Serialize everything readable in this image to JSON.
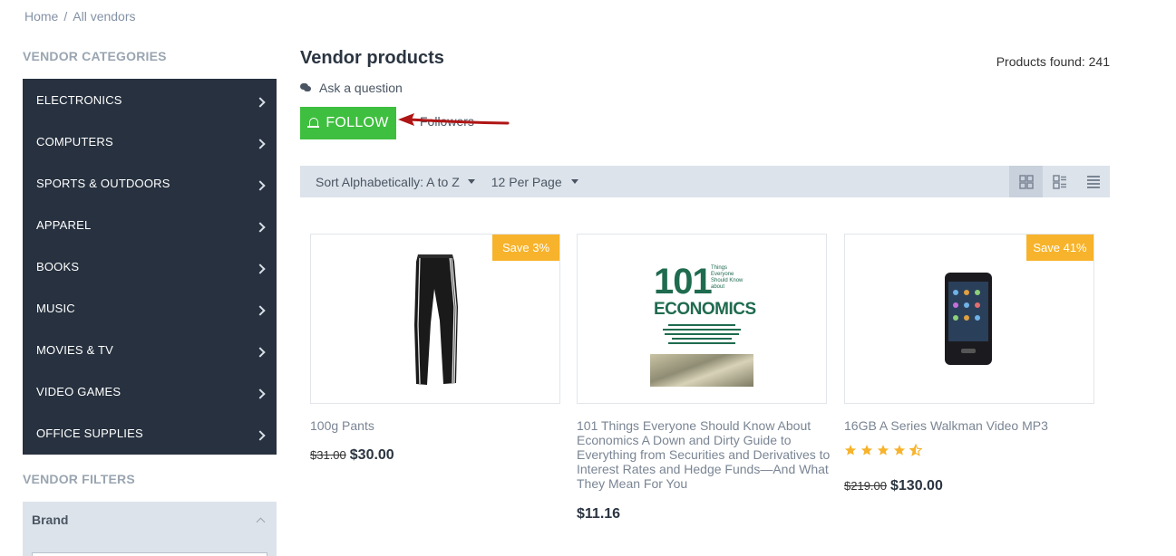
{
  "breadcrumb": {
    "home": "Home",
    "separator": "/",
    "current": "All vendors"
  },
  "sidebar": {
    "categories_title": "VENDOR CATEGORIES",
    "categories": [
      {
        "label": "ELECTRONICS"
      },
      {
        "label": "COMPUTERS"
      },
      {
        "label": "SPORTS & OUTDOORS"
      },
      {
        "label": "APPAREL"
      },
      {
        "label": "BOOKS"
      },
      {
        "label": "MUSIC"
      },
      {
        "label": "MOVIES & TV"
      },
      {
        "label": "VIDEO GAMES"
      },
      {
        "label": "OFFICE SUPPLIES"
      }
    ],
    "filters_title": "VENDOR FILTERS",
    "brand_filter": {
      "label": "Brand"
    }
  },
  "main": {
    "title": "Vendor products",
    "products_found": "Products found: 241",
    "ask_question": "Ask a question",
    "follow_label": "FOLLOW",
    "followers_label": "Followers",
    "sort_label": "Sort Alphabetically: A to Z",
    "per_page_label": "12 Per Page"
  },
  "products": [
    {
      "name": "100g Pants",
      "badge": "Save 3%",
      "old_price": "$31.00",
      "price": "$30.00",
      "image": "black-track-pants"
    },
    {
      "name": "101 Things Everyone Should Know About Economics A Down and Dirty Guide to Everything from Securities and Derivatives to Interest Rates and Hedge Funds—And What They Mean For You",
      "badge": "",
      "old_price": "",
      "price": "$11.16",
      "image": "economics-book-cover",
      "cover": {
        "number": "101",
        "word": "ECONOMICS",
        "side": "Things Everyone Should Know about"
      }
    },
    {
      "name": "16GB A Series Walkman Video MP3",
      "badge": "Save 41%",
      "old_price": "$219.00",
      "price": "$130.00",
      "rating": 4.5,
      "image": "walkman-mp3-player"
    }
  ],
  "colors": {
    "sidebar_bg": "#27313f",
    "follow_green": "#3fbf3f",
    "badge_orange": "#f7b32b",
    "toolbar_bg": "#dde3ea",
    "star": "#f7b32b",
    "arrow": "#b01515"
  }
}
